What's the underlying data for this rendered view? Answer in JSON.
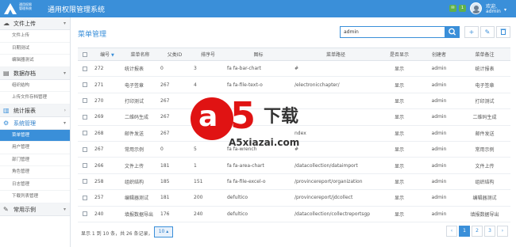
{
  "app": {
    "logo_line1": "通用权限",
    "logo_line2": "管理系统",
    "title": "通用权限管理系统",
    "notif_a": "",
    "notif_b": "1",
    "greeting": "欢迎,",
    "username": "admin"
  },
  "sidebar": {
    "groups": [
      {
        "label": "文件上传",
        "icon": "cloud-upload-icon",
        "items": [
          "文件上传",
          "日期测试",
          "编辑器测试"
        ]
      },
      {
        "label": "数据存档",
        "icon": "database-icon",
        "items": [
          "组织结构",
          "上传文件存档管理"
        ]
      },
      {
        "label": "统计报表",
        "icon": "bar-chart-icon",
        "items": []
      },
      {
        "label": "系统管理",
        "icon": "gear-icon",
        "items": [
          "菜单管理",
          "用户管理",
          "部门管理",
          "角色管理",
          "日志管理",
          "下载列表管理"
        ]
      },
      {
        "label": "常用示例",
        "icon": "wrench-icon",
        "items": []
      }
    ]
  },
  "main": {
    "page_title": "菜单管理",
    "search_value": "admin",
    "columns": [
      "编号",
      "菜单名称",
      "父类ID",
      "排序号",
      "图标",
      "菜单路径",
      "是否显示",
      "创建者",
      "菜单备注"
    ],
    "rows": [
      [
        "272",
        "统计报表",
        "0",
        "3",
        "fa fa-bar-chart",
        "#",
        "显示",
        "admin",
        "统计报表"
      ],
      [
        "271",
        "电子签章",
        "267",
        "4",
        "fa fa-file-text-o",
        "/electronicchapter/",
        "显示",
        "admin",
        "电子签章"
      ],
      [
        "270",
        "打印测试",
        "267",
        "",
        "",
        "",
        "显示",
        "admin",
        "打印测试"
      ],
      [
        "269",
        "二维码生成",
        "267",
        "",
        "",
        "",
        "显示",
        "admin",
        "二维码生成"
      ],
      [
        "268",
        "邮件发送",
        "267",
        "",
        "",
        "ndex",
        "显示",
        "admin",
        "邮件发送"
      ],
      [
        "267",
        "常用示例",
        "0",
        "5",
        "fa fa-wrench",
        "#",
        "显示",
        "admin",
        "常用示例"
      ],
      [
        "266",
        "文件上传",
        "181",
        "1",
        "fa fa-area-chart",
        "/datacollection/dataimport",
        "显示",
        "admin",
        "文件上传"
      ],
      [
        "258",
        "组织结构",
        "185",
        "151",
        "fa fa-file-excel-o",
        "/provincereport/organization",
        "显示",
        "admin",
        "组织结构"
      ],
      [
        "257",
        "编辑器测试",
        "181",
        "200",
        "defultico",
        "/provincereport/jdcollect",
        "显示",
        "admin",
        "编辑器测试"
      ],
      [
        "240",
        "填报数据导出",
        "176",
        "240",
        "defultico",
        "/datacollection/collectreportsgp",
        "显示",
        "admin",
        "填报数据导出"
      ]
    ],
    "footer_info": "显示 1 到 10 条，共 26 条记录，",
    "page_size": "10 ▴",
    "pages": [
      "‹",
      "1",
      "2",
      "3",
      "›"
    ],
    "active_page": "1"
  },
  "watermark": {
    "circle_letter": "a",
    "digit": "5",
    "chinese": "下载",
    "url": "A5xiazai.com"
  },
  "colors": {
    "accent": "#3a8fd9",
    "watermark_red": "#e01313",
    "badge_green": "#5fb14a"
  }
}
